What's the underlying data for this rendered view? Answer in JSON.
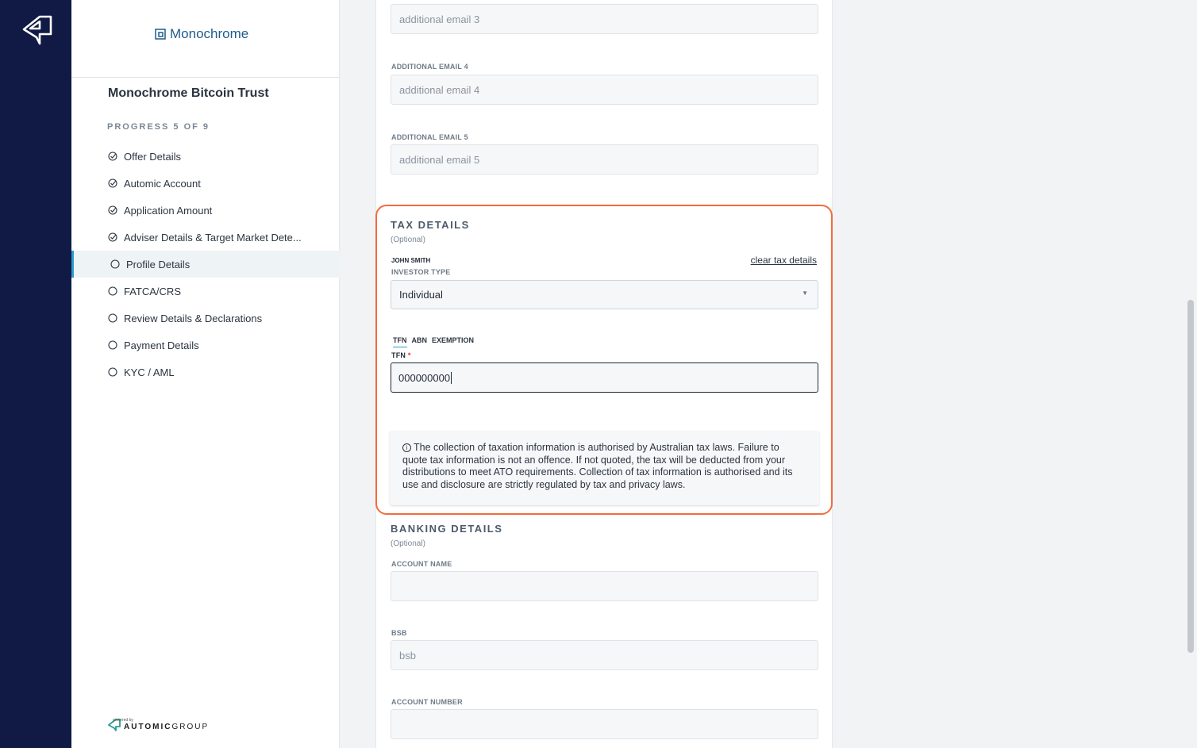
{
  "sidebar": {
    "brand_name": "Monochrome",
    "offer_title": "Monochrome Bitcoin Trust",
    "progress_label": "PROGRESS 5 OF 9",
    "steps": [
      {
        "label": "Offer Details",
        "status": "done"
      },
      {
        "label": "Automic Account",
        "status": "done"
      },
      {
        "label": "Application Amount",
        "status": "done"
      },
      {
        "label": "Adviser Details & Target Market Dete...",
        "status": "done"
      },
      {
        "label": "Profile Details",
        "status": "current"
      },
      {
        "label": "FATCA/CRS",
        "status": "pending"
      },
      {
        "label": "Review Details & Declarations",
        "status": "pending"
      },
      {
        "label": "Payment Details",
        "status": "pending"
      },
      {
        "label": "KYC / AML",
        "status": "pending"
      }
    ],
    "powered_by": "powered by",
    "footer_brand_a": "AUTOMIC",
    "footer_brand_b": "GROUP"
  },
  "emails": {
    "email3_placeholder": "additional email 3",
    "email4_label": "ADDITIONAL EMAIL 4",
    "email4_placeholder": "additional email 4",
    "email5_label": "ADDITIONAL EMAIL 5",
    "email5_placeholder": "additional email 5"
  },
  "tax": {
    "title": "TAX DETAILS",
    "optional": "(Optional)",
    "investor_name": "JOHN SMITH",
    "clear_link": "clear tax details",
    "investor_type_label": "INVESTOR TYPE",
    "investor_type_value": "Individual",
    "tabs": [
      "TFN",
      "ABN",
      "EXEMPTION"
    ],
    "tfn_label": "TFN",
    "tfn_required": "*",
    "tfn_value": "000000000",
    "notice": "The collection of taxation information is authorised by Australian tax laws. Failure to quote tax information is not an offence. If not quoted, the tax will be deducted from your distributions to meet ATO requirements. Collection of tax information is authorised and its use and disclosure are strictly regulated by tax and privacy laws."
  },
  "banking": {
    "title": "BANKING DETAILS",
    "optional": "(Optional)",
    "account_name_label": "ACCOUNT NAME",
    "account_name_value": "",
    "bsb_label": "BSB",
    "bsb_placeholder": "bsb",
    "account_number_label": "ACCOUNT NUMBER",
    "account_number_value": ""
  },
  "colors": {
    "rail": "#101a44",
    "highlight": "#f26d3d",
    "accent": "#2e9ccf",
    "brand": "#1f5d8a"
  }
}
